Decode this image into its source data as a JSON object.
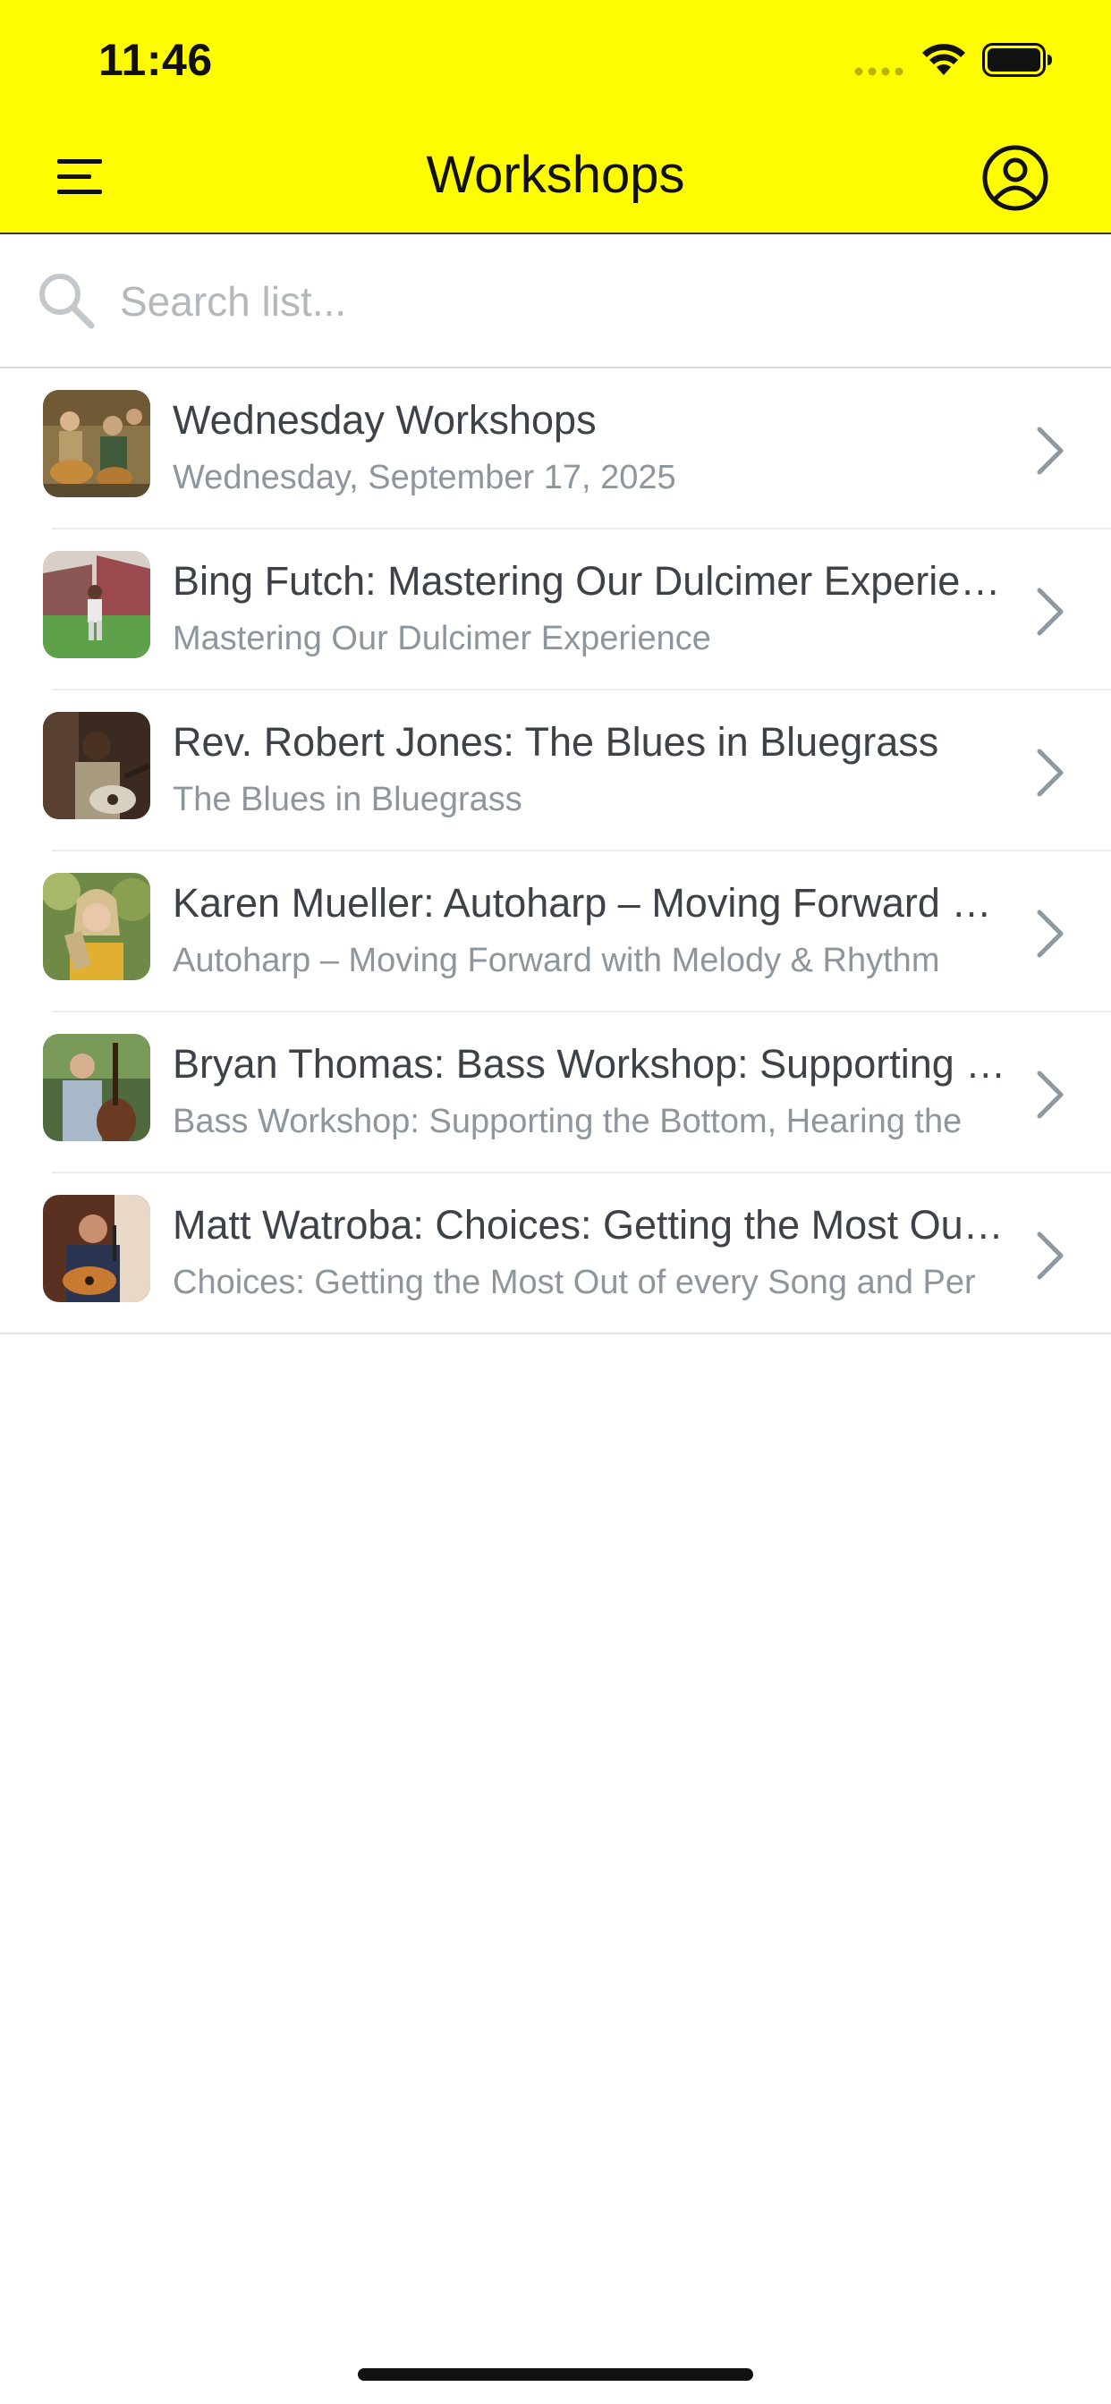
{
  "status_bar": {
    "time": "11:46"
  },
  "header": {
    "title": "Workshops",
    "background_color": "#FFFB00",
    "left_icon": "menu-icon",
    "right_icon": "profile-icon"
  },
  "search": {
    "placeholder": "Search list...",
    "value": "",
    "icon": "search-icon"
  },
  "list": {
    "items": [
      {
        "title": "Wednesday Workshops",
        "subtitle": "Wednesday, September 17, 2025",
        "thumbnail": "musicians-group-photo"
      },
      {
        "title": "Bing Futch: Mastering Our Dulcimer Experience",
        "subtitle": "Mastering Our Dulcimer Experience",
        "thumbnail": "performer-barn-photo"
      },
      {
        "title": "Rev. Robert Jones: The Blues in Bluegrass",
        "subtitle": "The Blues in Bluegrass",
        "thumbnail": "guitarist-photo"
      },
      {
        "title": "Karen Mueller: Autoharp – Moving Forward with Melody & Rhythm",
        "subtitle": "Autoharp – Moving Forward with Melody & Rhythm",
        "thumbnail": "autoharp-player-photo"
      },
      {
        "title": "Bryan Thomas: Bass Workshop: Supporting the Bottom, Hearing the Changes",
        "subtitle": "Bass Workshop: Supporting the Bottom, Hearing the",
        "thumbnail": "bassist-photo"
      },
      {
        "title": "Matt Watroba: Choices: Getting the Most Out of every Song and Performance",
        "subtitle": "Choices: Getting the Most Out of every Song and Per",
        "thumbnail": "singer-guitarist-photo"
      }
    ]
  }
}
